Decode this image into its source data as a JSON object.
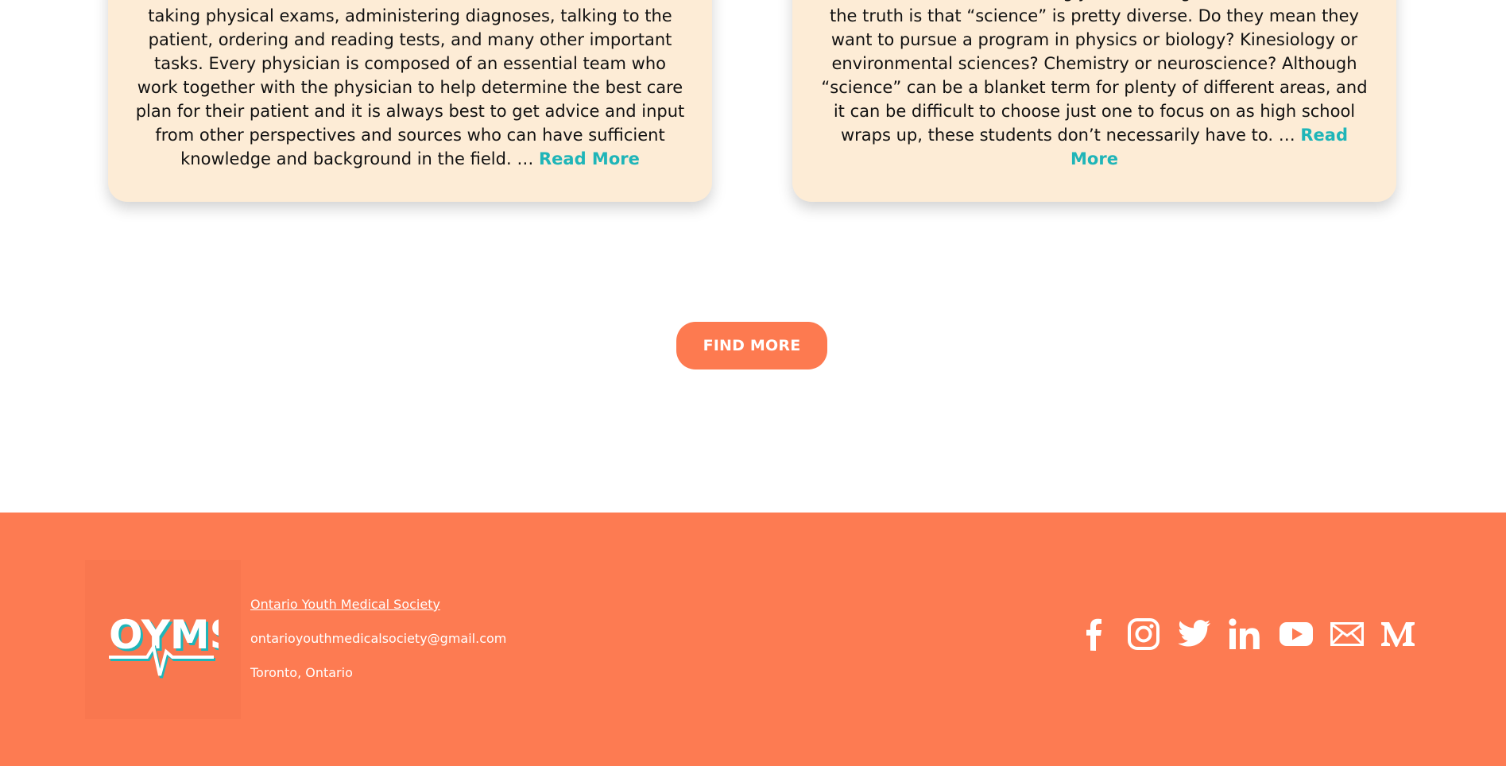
{
  "articles": [
    {
      "text": "taking physical exams, administering diagnoses, talking to the patient, ordering and reading tests, and many other important tasks. Every physician is composed of an essential team who work together with the physician to help determine the best care plan for their patient and it is always best to get advice and input from other perspectives and sources who can have sufficient knowledge and background in the field. … ",
      "read_more": "Read More"
    },
    {
      "text": "answer is often overwhelmingly “I want to go into science.” Well, the truth is that “science” is pretty diverse. Do they mean they want to pursue a program in physics or biology? Kinesiology or environmental sciences? Chemistry or neuroscience? Although “science” can be a blanket term for plenty of different areas, and it can be difficult to choose just one to focus on as high school wraps up, these students don’t necessarily have to. … ",
      "read_more": "Read More"
    }
  ],
  "find_more_label": "FIND MORE",
  "footer": {
    "logo_text": "OYMS",
    "org_name": "Ontario Youth Medical Society",
    "email": "ontarioyouthmedicalsociety@gmail.com",
    "location": "Toronto, Ontario",
    "social_icons": [
      "facebook-icon",
      "instagram-icon",
      "twitter-icon",
      "linkedin-icon",
      "youtube-icon",
      "email-icon",
      "medium-icon"
    ]
  },
  "colors": {
    "accent": "#fd7b52",
    "card_bg": "#fdecd6",
    "link_teal": "#1fb5b8"
  }
}
